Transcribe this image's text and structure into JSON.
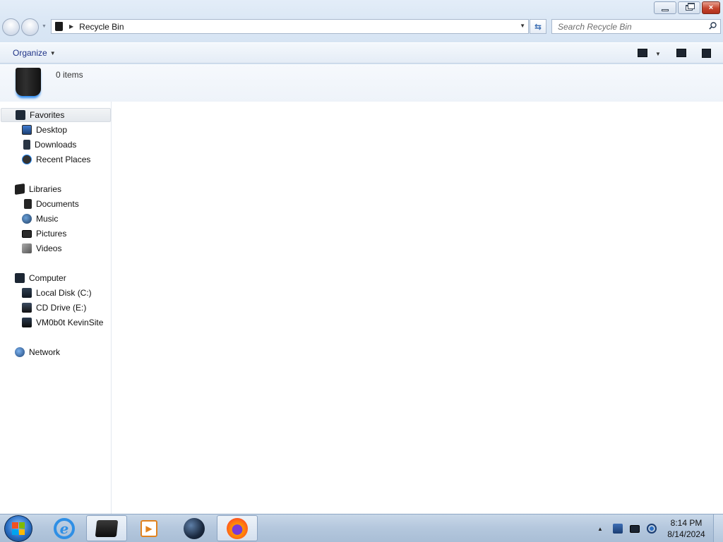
{
  "window": {
    "title": "Recycle Bin",
    "caption": {
      "minimize": "minimize",
      "maximize": "restore",
      "close": "×"
    }
  },
  "address_bar": {
    "path": "Recycle Bin",
    "location_icon": "recycle-bin-icon"
  },
  "search": {
    "placeholder": "Search Recycle Bin"
  },
  "toolbar": {
    "organize_label": "Organize",
    "icons": [
      "views-icon",
      "preview-pane-icon",
      "help-icon"
    ]
  },
  "details": {
    "item_count": "0 items"
  },
  "navigation": {
    "favorites": {
      "label": "Favorites",
      "items": [
        "Desktop",
        "Downloads",
        "Recent Places"
      ]
    },
    "libraries": {
      "label": "Libraries",
      "items": [
        "Documents",
        "Music",
        "Pictures",
        "Videos"
      ]
    },
    "computer": {
      "label": "Computer",
      "items": [
        "Local Disk (C:)",
        "CD Drive (E:)",
        "VM0b0t KevinSite"
      ]
    },
    "network": {
      "label": "Network"
    }
  },
  "taskbar": {
    "pinned": [
      "internet-explorer-icon",
      "windows-explorer-icon",
      "media-player-icon",
      "browser-globe-icon",
      "firefox-icon"
    ],
    "active": "windows-explorer-icon",
    "clock": {
      "time": "8:14 PM",
      "date": "8/14/2024"
    }
  },
  "colors": {
    "chrome": "#d9e6f4",
    "close_button": "#c5452e",
    "accent": "#2c8af0",
    "taskbar": "#b4c7dd"
  }
}
